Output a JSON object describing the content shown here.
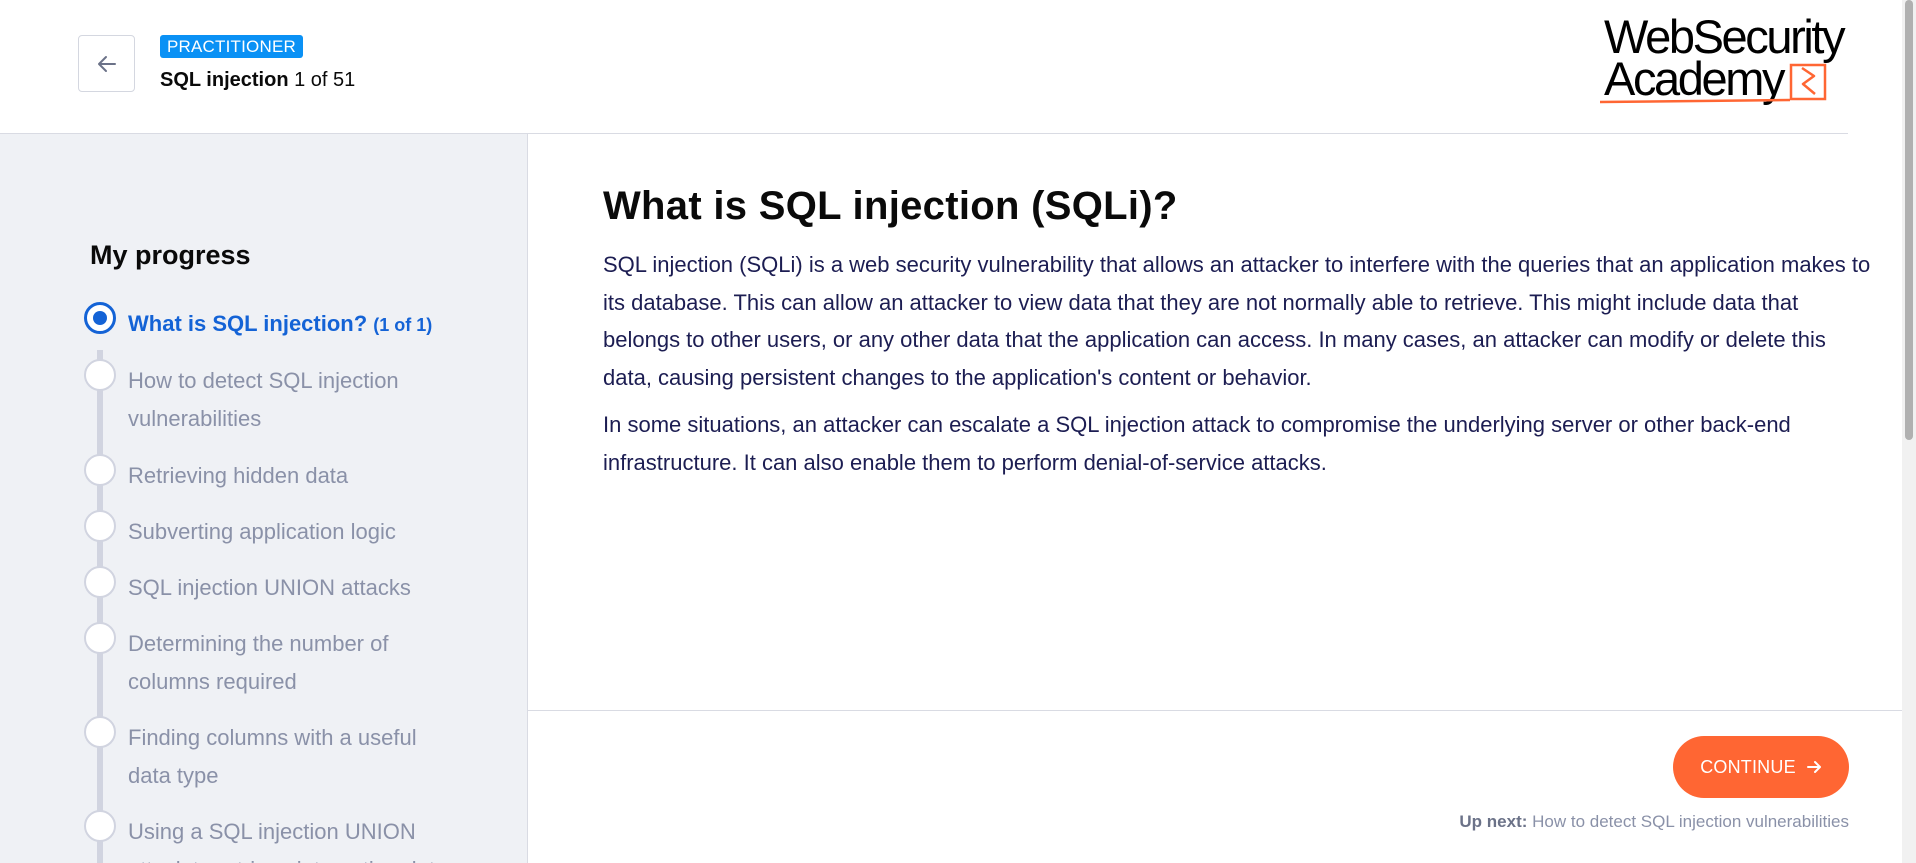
{
  "header": {
    "badge": "PRACTITIONER",
    "course_name": "SQL injection",
    "course_progress": "1 of 51",
    "logo_line1": "WebSecurity",
    "logo_line2": "Academy",
    "back_icon": "arrow-left-icon"
  },
  "sidebar": {
    "title": "My progress",
    "items": [
      {
        "label": "What is SQL injection?",
        "count": "(1 of 1)",
        "active": true
      },
      {
        "label": "How to detect SQL injection vulnerabilities"
      },
      {
        "label": "Retrieving hidden data"
      },
      {
        "label": "Subverting application logic"
      },
      {
        "label": "SQL injection UNION attacks"
      },
      {
        "label": "Determining the number of columns required"
      },
      {
        "label": "Finding columns with a useful data type"
      },
      {
        "label": "Using a SQL injection UNION attack to retrieve interesting data"
      }
    ]
  },
  "main": {
    "heading": "What is SQL injection (SQLi)?",
    "paragraphs": [
      "SQL injection (SQLi) is a web security vulnerability that allows an attacker to interfere with the queries that an application makes to its database. This can allow an attacker to view data that they are not normally able to retrieve. This might include data that belongs to other users, or any other data that the application can access. In many cases, an attacker can modify or delete this data, causing persistent changes to the application's content or behavior.",
      "In some situations, an attacker can escalate a SQL injection attack to compromise the underlying server or other back-end infrastructure. It can also enable them to perform denial-of-service attacks."
    ],
    "continue_label": "CONTINUE",
    "continue_icon": "arrow-right-icon",
    "up_next_label": "Up next:",
    "up_next_value": "How to detect SQL injection vulnerabilities"
  },
  "colors": {
    "accent": "#ff6633",
    "active_blue": "#1463d6",
    "badge_blue": "#0a91f5",
    "body_text": "#1c1d52",
    "muted": "#8a91a8",
    "sidebar_bg": "#eff1f5"
  }
}
